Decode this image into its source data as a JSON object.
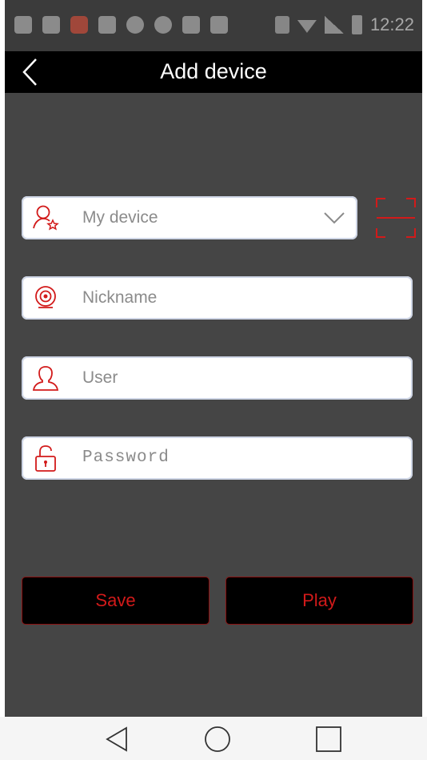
{
  "status_bar": {
    "time": "12:22"
  },
  "header": {
    "title": "Add device"
  },
  "form": {
    "device_select": {
      "value": "My device"
    },
    "nickname": {
      "placeholder": "Nickname"
    },
    "user": {
      "placeholder": "User"
    },
    "password": {
      "placeholder": "Password"
    }
  },
  "buttons": {
    "save": "Save",
    "play": "Play"
  },
  "colors": {
    "accent": "#d21a1a",
    "background": "#454545",
    "titlebar": "#000000"
  },
  "icons": {
    "back": "chevron-left-icon",
    "device": "user-star-icon",
    "camera": "camera-icon",
    "user": "user-icon",
    "lock": "lock-icon",
    "dropdown": "chevron-down-icon",
    "scan": "qr-scan-icon"
  }
}
